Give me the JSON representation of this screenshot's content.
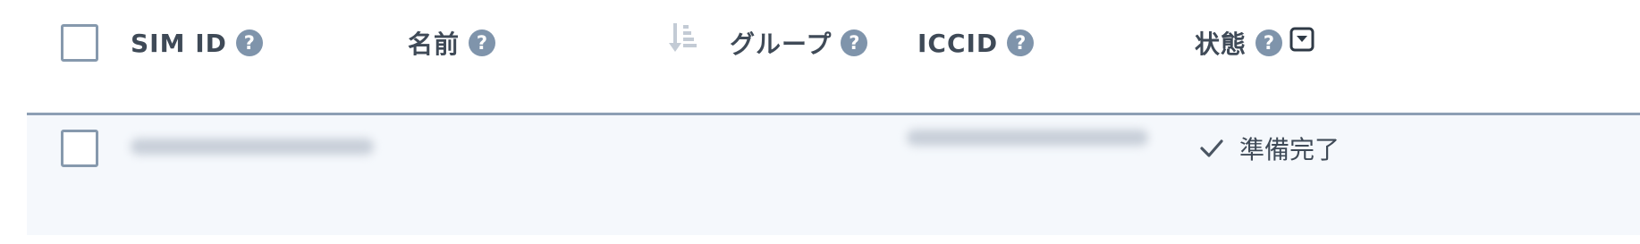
{
  "table": {
    "columns": {
      "sim_id": "SIM ID",
      "name": "名前",
      "group": "グループ",
      "iccid": "ICCID",
      "status": "状態"
    },
    "help_glyph": "?",
    "icons": {
      "help": "question-circle-icon",
      "sort": "sort-descending-icon",
      "filter": "filter-dropdown-icon",
      "status_check": "checkmark-icon"
    },
    "rows": [
      {
        "status": "準備完了"
      }
    ]
  }
}
